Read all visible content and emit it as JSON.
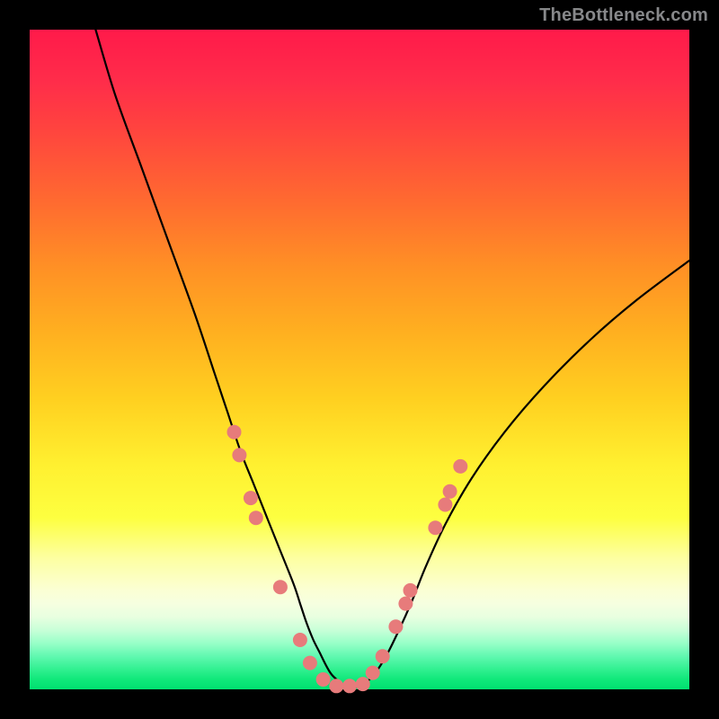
{
  "watermark": "TheBottleneck.com",
  "chart_data": {
    "type": "line",
    "title": "",
    "xlabel": "",
    "ylabel": "",
    "xlim": [
      0,
      100
    ],
    "ylim": [
      0,
      100
    ],
    "background": "rainbow-gradient-red-to-green",
    "curve": {
      "name": "bottleneck-curve",
      "x": [
        10,
        13,
        17,
        21,
        25,
        28,
        30,
        32,
        34,
        36,
        38,
        40,
        41,
        42,
        43,
        44,
        45,
        46,
        48,
        50,
        52,
        54,
        56,
        58,
        60,
        63,
        67,
        72,
        78,
        85,
        92,
        100
      ],
      "y": [
        100,
        90,
        79,
        68,
        57,
        48,
        42,
        36,
        31,
        26,
        21,
        16,
        13,
        10,
        7.5,
        5.5,
        3.5,
        2.0,
        0.5,
        0.5,
        2.0,
        5.0,
        9.0,
        13.5,
        18.5,
        25,
        32,
        39,
        46,
        53,
        59,
        65
      ]
    },
    "markers": {
      "name": "data-points",
      "color": "#e77b7b",
      "radius_px": 8,
      "points": [
        {
          "x": 31.0,
          "y": 39.0
        },
        {
          "x": 31.8,
          "y": 35.5
        },
        {
          "x": 33.5,
          "y": 29.0
        },
        {
          "x": 34.3,
          "y": 26.0
        },
        {
          "x": 38.0,
          "y": 15.5
        },
        {
          "x": 41.0,
          "y": 7.5
        },
        {
          "x": 42.5,
          "y": 4.0
        },
        {
          "x": 44.5,
          "y": 1.5
        },
        {
          "x": 46.5,
          "y": 0.5
        },
        {
          "x": 48.5,
          "y": 0.5
        },
        {
          "x": 50.5,
          "y": 0.8
        },
        {
          "x": 52.0,
          "y": 2.5
        },
        {
          "x": 53.5,
          "y": 5.0
        },
        {
          "x": 55.5,
          "y": 9.5
        },
        {
          "x": 57.0,
          "y": 13.0
        },
        {
          "x": 57.7,
          "y": 15.0
        },
        {
          "x": 61.5,
          "y": 24.5
        },
        {
          "x": 63.0,
          "y": 28.0
        },
        {
          "x": 63.7,
          "y": 30.0
        },
        {
          "x": 65.3,
          "y": 33.8
        }
      ]
    }
  }
}
